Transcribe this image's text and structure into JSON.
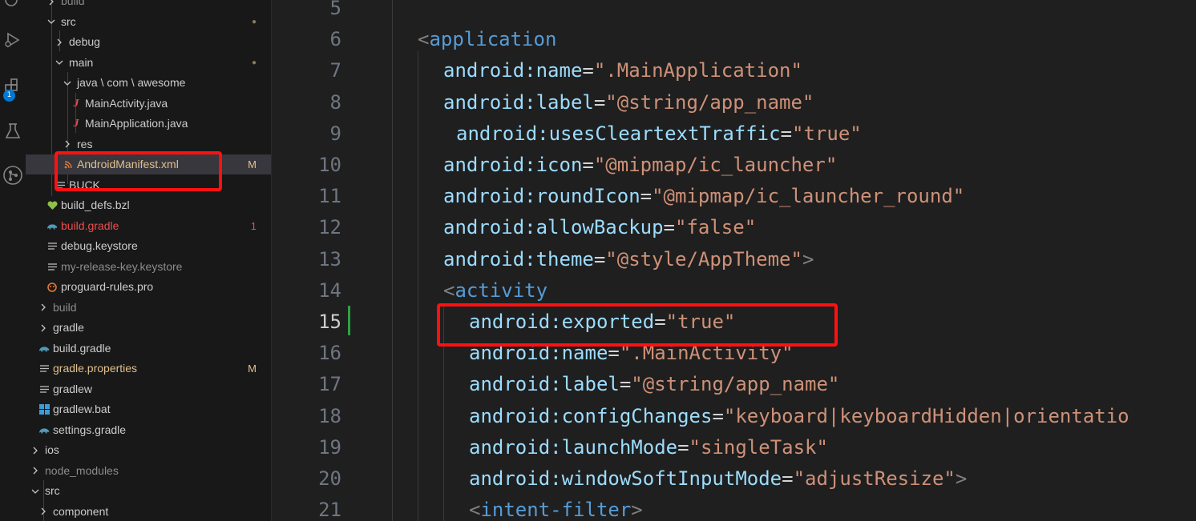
{
  "activity_bar": {
    "icons": [
      "files-icon",
      "run-debug-icon",
      "extensions-icon",
      "testing-icon",
      "git-graph-icon"
    ],
    "badge": "1"
  },
  "explorer": {
    "rows": [
      {
        "label": "build",
        "kind": "folder",
        "open": false,
        "icon": "none",
        "decor": ""
      },
      {
        "label": "src",
        "kind": "folder",
        "open": true,
        "icon": "none",
        "decor": "●"
      },
      {
        "label": "debug",
        "kind": "folder",
        "open": false,
        "icon": "none",
        "decor": ""
      },
      {
        "label": "main",
        "kind": "folder",
        "open": true,
        "icon": "none",
        "decor": "●"
      },
      {
        "label": "java \\ com \\ awesome",
        "kind": "folder",
        "open": true,
        "icon": "none",
        "decor": ""
      },
      {
        "label": "MainActivity.java",
        "kind": "file",
        "icon": "java-icon",
        "decor": ""
      },
      {
        "label": "MainApplication.java",
        "kind": "file",
        "icon": "java-icon",
        "decor": ""
      },
      {
        "label": "res",
        "kind": "folder",
        "open": false,
        "icon": "none",
        "decor": ""
      },
      {
        "label": "AndroidManifest.xml",
        "kind": "file",
        "icon": "rss-icon",
        "decor": "M",
        "selected": true
      },
      {
        "label": "BUCK",
        "kind": "file",
        "icon": "lines-icon",
        "decor": ""
      },
      {
        "label": "build_defs.bzl",
        "kind": "file",
        "icon": "heart-icon",
        "decor": ""
      },
      {
        "label": "build.gradle",
        "kind": "file",
        "icon": "elephant-icon",
        "decor": "1"
      },
      {
        "label": "debug.keystore",
        "kind": "file",
        "icon": "lines-icon",
        "decor": ""
      },
      {
        "label": "my-release-key.keystore",
        "kind": "file",
        "icon": "lines-icon",
        "decor": ""
      },
      {
        "label": "proguard-rules.pro",
        "kind": "file",
        "icon": "proguard-icon",
        "decor": ""
      },
      {
        "label": "build",
        "kind": "folder",
        "open": false,
        "icon": "none",
        "decor": ""
      },
      {
        "label": "gradle",
        "kind": "folder",
        "open": false,
        "icon": "none",
        "decor": ""
      },
      {
        "label": "build.gradle",
        "kind": "file",
        "icon": "elephant-icon",
        "decor": ""
      },
      {
        "label": "gradle.properties",
        "kind": "file",
        "icon": "lines-icon",
        "decor": "M"
      },
      {
        "label": "gradlew",
        "kind": "file",
        "icon": "lines-icon",
        "decor": ""
      },
      {
        "label": "gradlew.bat",
        "kind": "file",
        "icon": "windows-icon",
        "decor": ""
      },
      {
        "label": "settings.gradle",
        "kind": "file",
        "icon": "elephant-icon",
        "decor": ""
      },
      {
        "label": "ios",
        "kind": "folder",
        "open": false,
        "icon": "none",
        "decor": ""
      },
      {
        "label": "node_modules",
        "kind": "folder",
        "open": false,
        "icon": "none",
        "decor": ""
      },
      {
        "label": "src",
        "kind": "folder",
        "open": true,
        "icon": "none",
        "decor": ""
      },
      {
        "label": "component",
        "kind": "folder",
        "open": false,
        "icon": "none",
        "decor": ""
      }
    ]
  },
  "editor": {
    "lines": [
      {
        "n": "5",
        "tokens": []
      },
      {
        "n": "6",
        "tokens": [
          {
            "t": "<",
            "c": "pun"
          },
          {
            "t": "application",
            "c": "tag"
          }
        ]
      },
      {
        "n": "7",
        "tokens": [
          {
            "t": "android:name",
            "c": "attr"
          },
          {
            "t": "=",
            "c": "eq"
          },
          {
            "t": "\".MainApplication\"",
            "c": "str"
          }
        ]
      },
      {
        "n": "8",
        "tokens": [
          {
            "t": "android:label",
            "c": "attr"
          },
          {
            "t": "=",
            "c": "eq"
          },
          {
            "t": "\"@string/app_name\"",
            "c": "str"
          }
        ]
      },
      {
        "n": "9",
        "tokens": [
          {
            "t": "android:usesCleartextTraffic",
            "c": "attr"
          },
          {
            "t": "=",
            "c": "eq"
          },
          {
            "t": "\"true\"",
            "c": "str"
          }
        ]
      },
      {
        "n": "10",
        "tokens": [
          {
            "t": "android:icon",
            "c": "attr"
          },
          {
            "t": "=",
            "c": "eq"
          },
          {
            "t": "\"@mipmap/ic_launcher\"",
            "c": "str"
          }
        ]
      },
      {
        "n": "11",
        "tokens": [
          {
            "t": "android:roundIcon",
            "c": "attr"
          },
          {
            "t": "=",
            "c": "eq"
          },
          {
            "t": "\"@mipmap/ic_launcher_round\"",
            "c": "str"
          }
        ]
      },
      {
        "n": "12",
        "tokens": [
          {
            "t": "android:allowBackup",
            "c": "attr"
          },
          {
            "t": "=",
            "c": "eq"
          },
          {
            "t": "\"false\"",
            "c": "str"
          }
        ]
      },
      {
        "n": "13",
        "tokens": [
          {
            "t": "android:theme",
            "c": "attr"
          },
          {
            "t": "=",
            "c": "eq"
          },
          {
            "t": "\"@style/AppTheme\"",
            "c": "str"
          },
          {
            "t": ">",
            "c": "pun"
          }
        ]
      },
      {
        "n": "14",
        "tokens": [
          {
            "t": "<",
            "c": "pun"
          },
          {
            "t": "activity",
            "c": "tag"
          }
        ]
      },
      {
        "n": "15",
        "tokens": [
          {
            "t": "android:exported",
            "c": "attr"
          },
          {
            "t": "=",
            "c": "eq"
          },
          {
            "t": "\"true\"",
            "c": "str"
          }
        ]
      },
      {
        "n": "16",
        "tokens": [
          {
            "t": "android:name",
            "c": "attr"
          },
          {
            "t": "=",
            "c": "eq"
          },
          {
            "t": "\".MainActivity\"",
            "c": "str"
          }
        ]
      },
      {
        "n": "17",
        "tokens": [
          {
            "t": "android:label",
            "c": "attr"
          },
          {
            "t": "=",
            "c": "eq"
          },
          {
            "t": "\"@string/app_name\"",
            "c": "str"
          }
        ]
      },
      {
        "n": "18",
        "tokens": [
          {
            "t": "android:configChanges",
            "c": "attr"
          },
          {
            "t": "=",
            "c": "eq"
          },
          {
            "t": "\"keyboard|keyboardHidden|orientatio",
            "c": "str"
          }
        ]
      },
      {
        "n": "19",
        "tokens": [
          {
            "t": "android:launchMode",
            "c": "attr"
          },
          {
            "t": "=",
            "c": "eq"
          },
          {
            "t": "\"singleTask\"",
            "c": "str"
          }
        ]
      },
      {
        "n": "20",
        "tokens": [
          {
            "t": "android:windowSoftInputMode",
            "c": "attr"
          },
          {
            "t": "=",
            "c": "eq"
          },
          {
            "t": "\"adjustResize\"",
            "c": "str"
          },
          {
            "t": ">",
            "c": "pun"
          }
        ]
      },
      {
        "n": "21",
        "tokens": [
          {
            "t": "<",
            "c": "pun"
          },
          {
            "t": "intent-filter",
            "c": "tag"
          },
          {
            "t": ">",
            "c": "pun"
          }
        ]
      }
    ],
    "active_line": "15"
  },
  "colors": {
    "highlight_box": "#ff1111",
    "git_modified": "#e2c08d",
    "git_error": "#f14c4c",
    "git_ignored": "#8c8c8c",
    "modified_bar": "#2ea043"
  }
}
